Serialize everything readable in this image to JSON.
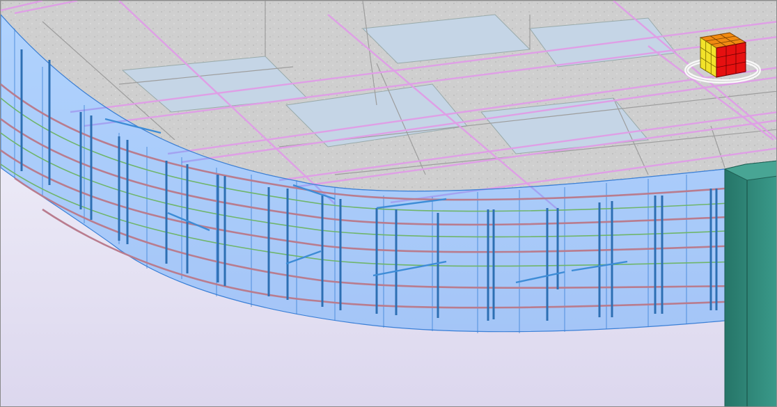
{
  "viewport": {
    "view_mode": "3D",
    "background_gradient": [
      "#f4f4fb",
      "#dcd8ee"
    ]
  },
  "colors": {
    "concrete": "#d0d0d0",
    "concrete_dark": "#bfbfbf",
    "void": "#c3d4e4",
    "formwork_glass": "#5aa9ff",
    "formwork_edge": "#3a7fd6",
    "rebar_vertical": "#2d6fb3",
    "rebar_horizontal": "#c0808f",
    "rebar_green": "#6fb56a",
    "pink_rebar": "#e0a4e6",
    "column": "#2f8a7c",
    "cube_top": "#f08a12",
    "cube_front": "#f2e22a",
    "cube_side": "#e61010"
  },
  "viewcube": {
    "icon": "viewcube-icon",
    "orbit_icon": "orbit-ring-icon"
  },
  "model": {
    "elements": [
      "concrete-slab",
      "curved-beam-formwork",
      "vertical-rebar",
      "horizontal-rebar",
      "top-reinforcement",
      "concrete-column"
    ]
  }
}
